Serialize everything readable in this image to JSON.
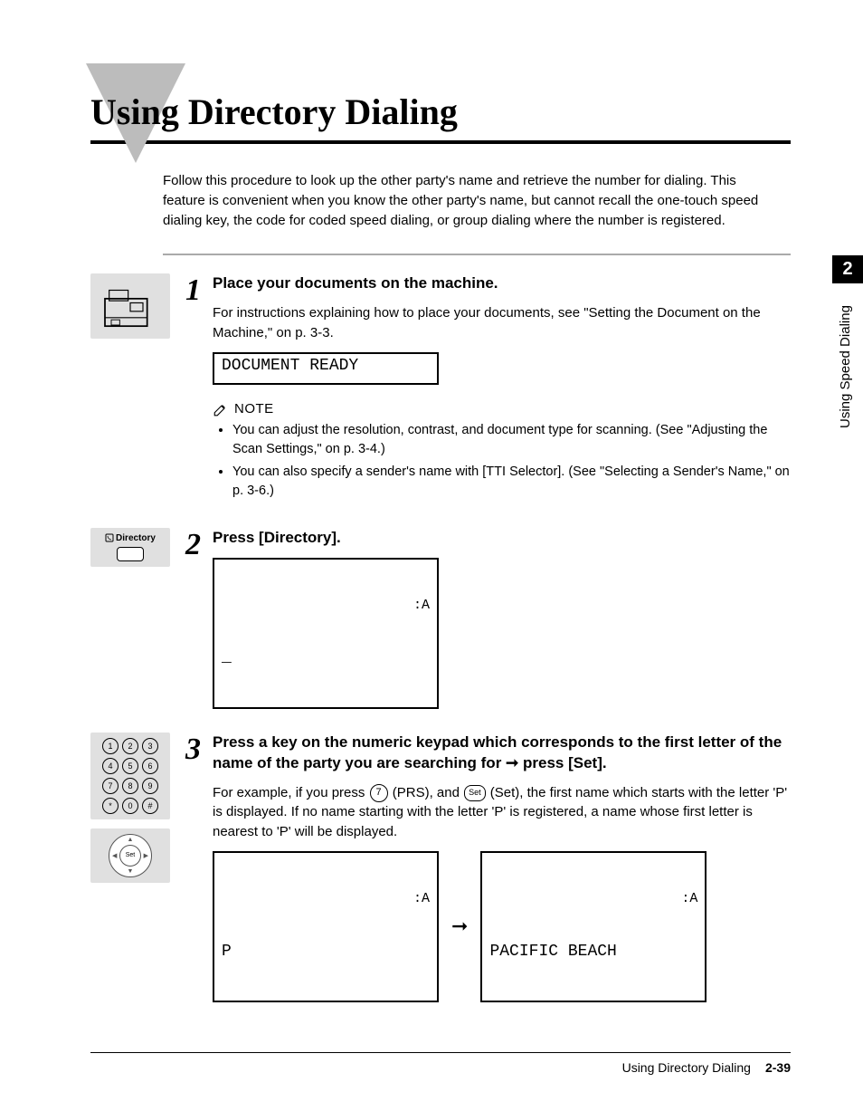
{
  "title": "Using Directory Dialing",
  "intro": "Follow this procedure to look up the other party's name and retrieve the number for dialing. This feature is convenient when you know the other party's name, but cannot recall the one-touch speed dialing key, the code for coded speed dialing, or group dialing where the number is registered.",
  "side_tab": {
    "number": "2",
    "label": "Using Speed Dialing"
  },
  "steps": {
    "s1": {
      "num": "1",
      "heading": "Place your documents on the machine.",
      "para": "For instructions explaining how to place your documents, see \"Setting the Document on the Machine,\" on p. 3-3.",
      "lcd": "DOCUMENT READY",
      "note_label": "NOTE",
      "notes": [
        "You can adjust the resolution, contrast, and document type for scanning. (See \"Adjusting the Scan Settings,\" on p. 3-4.)",
        "You can also specify a sender's name with [TTI Selector]. (See \"Selecting a Sender's Name,\" on p. 3-6.)"
      ]
    },
    "s2": {
      "num": "2",
      "heading": "Press [Directory].",
      "icon_label": "Directory",
      "lcd_top": ":A",
      "lcd_bottom": "_"
    },
    "s3": {
      "num": "3",
      "heading_pre": "Press a key on the numeric keypad which corresponds to the first letter of the name of the party you are searching for ",
      "heading_arrow": "➞",
      "heading_post": " press [Set].",
      "para_pre": "For example, if you press ",
      "key7": "7",
      "para_mid1": " (PRS), and ",
      "key_set": "Set",
      "para_mid2": " (Set), the first name which starts with the letter 'P' is displayed. If no name starting with the letter 'P' is registered, a name whose first letter is nearest to 'P' will be displayed.",
      "lcd1_top": ":A",
      "lcd1_bottom": "P",
      "arrow": "➞",
      "lcd2_top": ":A",
      "lcd2_bottom": "PACIFIC BEACH"
    }
  },
  "keypad": [
    "1",
    "2",
    "3",
    "4",
    "5",
    "6",
    "7",
    "8",
    "9",
    "*",
    "0",
    "#"
  ],
  "set_label": "Set",
  "footer": {
    "title": "Using Directory Dialing",
    "page": "2-39"
  }
}
